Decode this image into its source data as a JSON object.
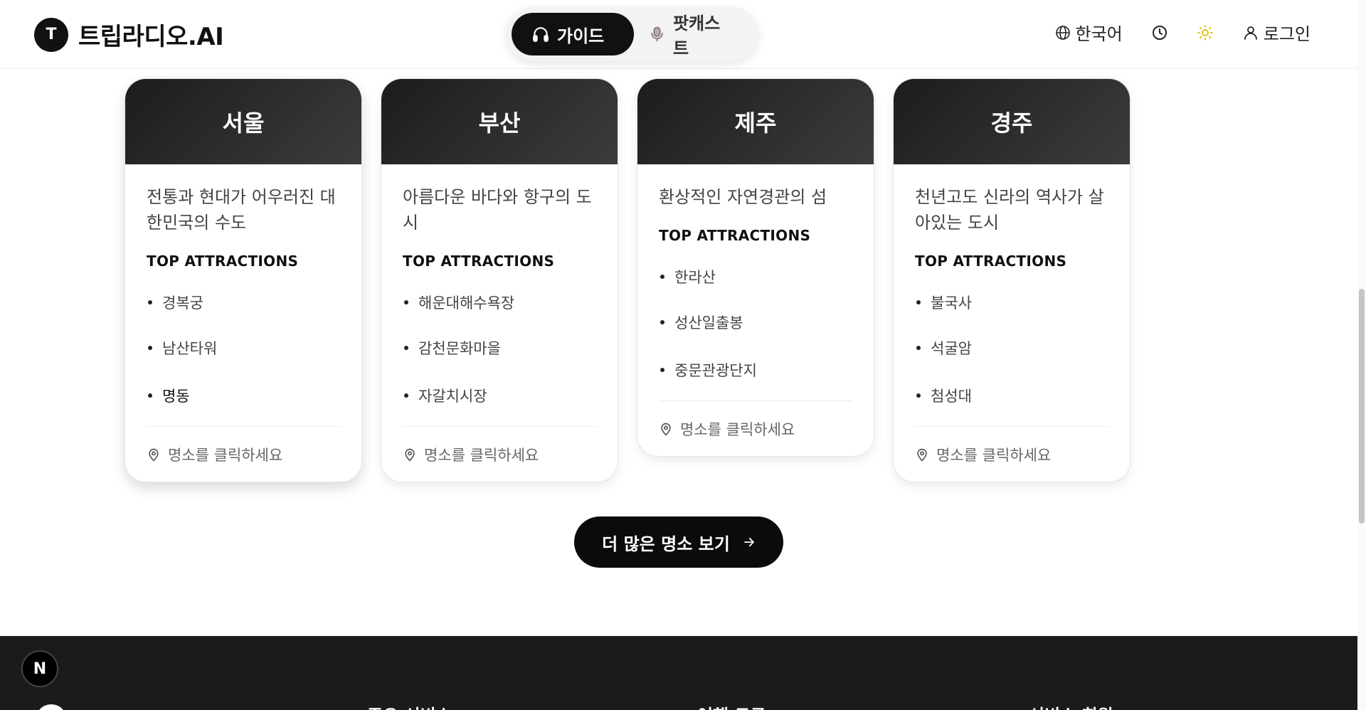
{
  "header": {
    "logo_letter": "T",
    "brand_name": "트립라디오.AI",
    "modes": [
      {
        "label": "가이드",
        "icon": "headphones-icon",
        "active": true
      },
      {
        "label": "팟캐스트",
        "icon": "microphone-icon",
        "active": false
      }
    ],
    "language_label": "한국어",
    "login_label": "로그인"
  },
  "cards": [
    {
      "city": "서울",
      "description": "전통과 현대가 어우러진 대한민국의 수도",
      "sub_heading": "TOP ATTRACTIONS",
      "attractions": [
        "경복궁",
        "남산타워",
        "명동"
      ],
      "footer_hint": "명소를 클릭하세요"
    },
    {
      "city": "부산",
      "description": "아름다운 바다와 항구의 도시",
      "sub_heading": "TOP ATTRACTIONS",
      "attractions": [
        "해운대해수욕장",
        "감천문화마을",
        "자갈치시장"
      ],
      "footer_hint": "명소를 클릭하세요"
    },
    {
      "city": "제주",
      "description": "환상적인 자연경관의 섬",
      "sub_heading": "TOP ATTRACTIONS",
      "attractions": [
        "한라산",
        "성산일출봉",
        "중문관광단지"
      ],
      "footer_hint": "명소를 클릭하세요"
    },
    {
      "city": "경주",
      "description": "천년고도 신라의 역사가 살아있는 도시",
      "sub_heading": "TOP ATTRACTIONS",
      "attractions": [
        "불국사",
        "석굴암",
        "첨성대"
      ],
      "footer_hint": "명소를 클릭하세요"
    }
  ],
  "more_button": {
    "label": "더 많은 명소 보기",
    "icon": "arrow-right-icon"
  },
  "footer": {
    "headings": [
      "주요 서비스",
      "여행 도구",
      "서비스 회원"
    ]
  },
  "badge": {
    "letter": "N"
  },
  "colors": {
    "accent_dark": "#111111",
    "sun_icon": "#e6b800",
    "footer_bg": "#1b1b1b"
  }
}
